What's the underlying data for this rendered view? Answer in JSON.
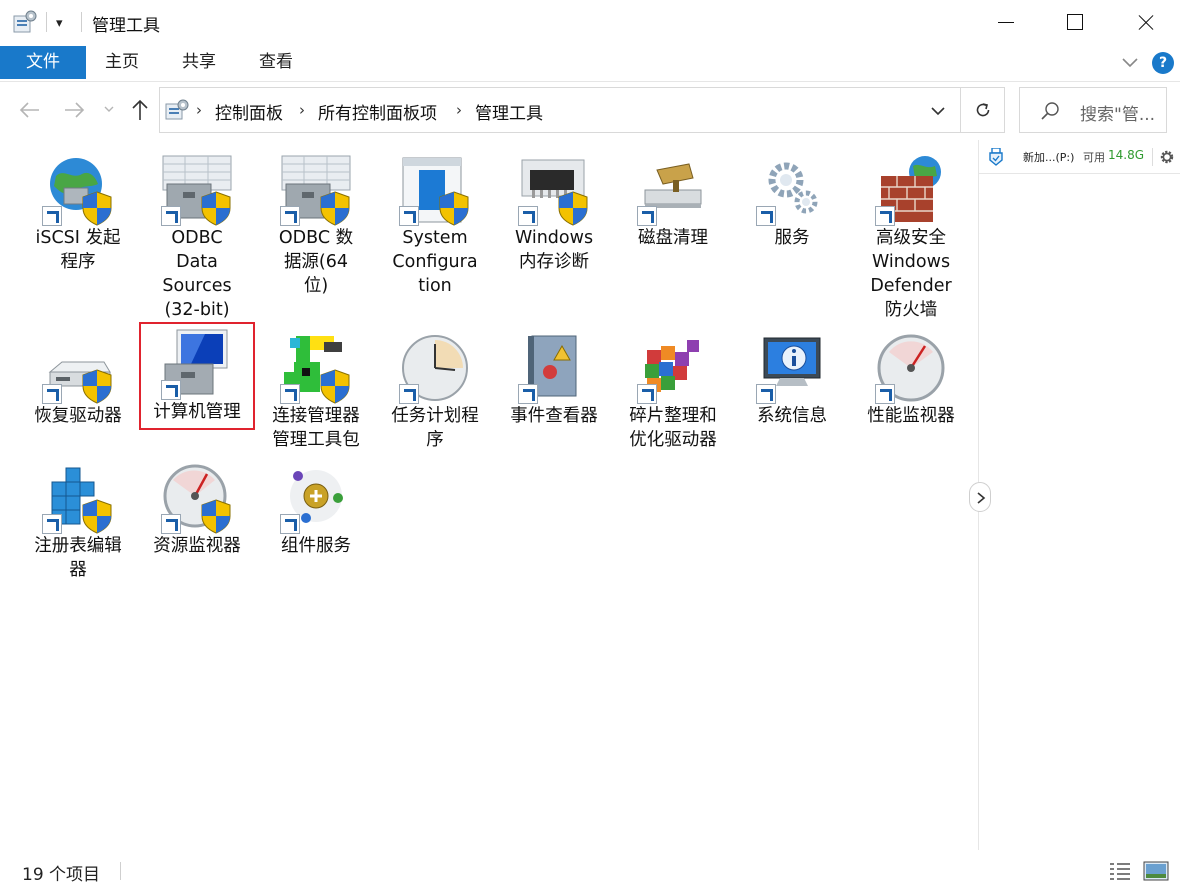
{
  "window": {
    "title": "管理工具",
    "quick_access_arrow": "▾"
  },
  "ribbon": {
    "tabs": {
      "file": "文件",
      "home": "主页",
      "share": "共享",
      "view": "查看"
    },
    "help": "?"
  },
  "address": {
    "crumbs": [
      "控制面板",
      "所有控制面板项",
      "管理工具"
    ],
    "separator": "›"
  },
  "search": {
    "placeholder": "搜索\"管..."
  },
  "items": [
    {
      "label": "iSCSI 发起程序",
      "icon": "globe-shield-icon",
      "lines": [
        "iSCSI 发起",
        "程序"
      ]
    },
    {
      "label": "ODBC Data Sources (32-bit)",
      "icon": "database-toolbox-icon",
      "lines": [
        "ODBC",
        "Data",
        "Sources",
        "(32-bit)"
      ]
    },
    {
      "label": "ODBC 数据源(64 位)",
      "icon": "database-toolbox-icon",
      "lines": [
        "ODBC 数",
        "据源(64",
        "位)"
      ]
    },
    {
      "label": "System Configuration",
      "icon": "system-config-icon",
      "lines": [
        "System",
        "Configura",
        "tion"
      ]
    },
    {
      "label": "Windows 内存诊断",
      "icon": "memory-chip-icon",
      "lines": [
        "Windows",
        "内存诊断"
      ]
    },
    {
      "label": "磁盘清理",
      "icon": "disk-cleanup-icon",
      "lines": [
        "磁盘清理"
      ]
    },
    {
      "label": "服务",
      "icon": "gears-icon",
      "lines": [
        "服务"
      ]
    },
    {
      "label": "高级安全 Windows Defender 防火墙",
      "icon": "firewall-icon",
      "lines": [
        "高级安全",
        "Windows",
        "Defender",
        "防火墙"
      ]
    },
    {
      "label": "恢复驱动器",
      "icon": "recovery-drive-icon",
      "lines": [
        "恢复驱动器"
      ]
    },
    {
      "label": "计算机管理",
      "icon": "computer-management-icon",
      "lines": [
        "计算机管理"
      ],
      "selected": true
    },
    {
      "label": "连接管理器管理工具包",
      "icon": "connection-manager-icon",
      "lines": [
        "连接管理器",
        "管理工具包"
      ]
    },
    {
      "label": "任务计划程序",
      "icon": "clock-icon",
      "lines": [
        "任务计划程",
        "序"
      ]
    },
    {
      "label": "事件查看器",
      "icon": "event-viewer-icon",
      "lines": [
        "事件查看器"
      ]
    },
    {
      "label": "碎片整理和优化驱动器",
      "icon": "defrag-icon",
      "lines": [
        "碎片整理和",
        "优化驱动器"
      ]
    },
    {
      "label": "系统信息",
      "icon": "system-info-icon",
      "lines": [
        "系统信息"
      ]
    },
    {
      "label": "性能监视器",
      "icon": "gauge-icon",
      "lines": [
        "性能监视器"
      ]
    },
    {
      "label": "注册表编辑器",
      "icon": "registry-cubes-icon",
      "lines": [
        "注册表编辑",
        "器"
      ]
    },
    {
      "label": "资源监视器",
      "icon": "gauge-shield-icon",
      "lines": [
        "资源监视器"
      ]
    },
    {
      "label": "组件服务",
      "icon": "component-services-icon",
      "lines": [
        "组件服务"
      ]
    }
  ],
  "right_panel": {
    "drive_name": "新加...(P:)",
    "avail_label": "可用",
    "avail_size": "14.8G"
  },
  "status": {
    "count": "19 个项目"
  },
  "colors": {
    "accent": "#1979ca",
    "selection_border": "#e0232e",
    "free_space": "#2f9a2f"
  }
}
